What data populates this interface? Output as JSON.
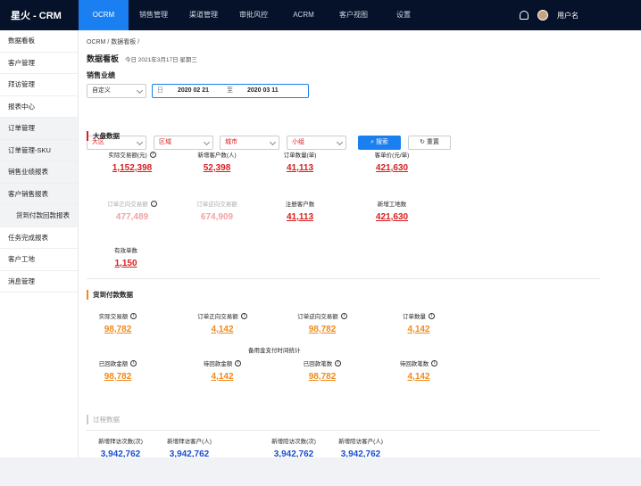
{
  "app": {
    "brand": "星火 - CRM"
  },
  "nav": {
    "items": [
      "OCRM",
      "销售管理",
      "渠道管理",
      "审批风控",
      "ACRM",
      "客户视图",
      "设置"
    ],
    "active_index": 0
  },
  "user": {
    "name": "用户名"
  },
  "sidebar": {
    "items": [
      "数据看板",
      "客户管理",
      "拜访管理",
      "报表中心",
      "订单管理",
      "订单管理-SKU",
      "销售业绩报表",
      "客户销售报表",
      "货到付款回款报表",
      "任务完成报表",
      "客户工地",
      "消息管理"
    ]
  },
  "breadcrumb": {
    "path": "OCRM / 数据看板 /"
  },
  "page": {
    "title": "数据看板",
    "date": "今日 2021年3月17日 星期三",
    "sales_label": "销售业绩"
  },
  "filters": {
    "date_mode": "自定义",
    "date_start": "2020 02 21",
    "date_to": "至",
    "date_end": "2020 03 11",
    "calendar_glyph": "日",
    "dropdowns": [
      "大区",
      "区域",
      "城市",
      "小组"
    ],
    "search_label": "搜索",
    "reset_label": "重置"
  },
  "sections": {
    "overview": "大盘数据",
    "cod": "货到付款数据",
    "process": "过程数据"
  },
  "overview_metrics": [
    {
      "label": "实际交易额(元)",
      "value": "1,152,398"
    },
    {
      "label": "新增客户数(人)",
      "value": "52,398"
    },
    {
      "label": "订单数量(单)",
      "value": "41,113"
    },
    {
      "label": "客单价(元/单)",
      "value": "421,630"
    },
    {
      "label": "订单正向交易额",
      "value": "477,489"
    },
    {
      "label": "订单逆向交易额",
      "value": "674,909"
    },
    {
      "label": "注册客户数",
      "value": "41,113"
    },
    {
      "label": "新增工地数",
      "value": "421,630"
    },
    {
      "label": "有效单数",
      "value": "1,150"
    }
  ],
  "cod_metrics": [
    {
      "label": "实际交易额",
      "value": "98,782"
    },
    {
      "label": "订单正向交易额",
      "value": "4,142"
    },
    {
      "label": "订单逆向交易额",
      "value": "98,782"
    },
    {
      "label": "订单数量",
      "value": "4,142"
    },
    {
      "label": "已回款金额",
      "value": "98,782"
    },
    {
      "label": "待回款金额",
      "value": "4,142"
    },
    {
      "label": "已回款笔数",
      "value": "98,782"
    },
    {
      "label": "待回款笔数",
      "value": "4,142"
    }
  ],
  "cod_note": "备用金支付时间统计",
  "process_metrics": [
    {
      "label": "新增拜访次数(次)",
      "value": "3,942,762"
    },
    {
      "label": "新增拜访客户(人)",
      "value": "3,942,762"
    },
    {
      "label": "新增陪访次数(次)",
      "value": "3,942,762"
    },
    {
      "label": "新增陪访客户(人)",
      "value": "3,942,762"
    }
  ],
  "colors": {
    "topbar": "#06122a",
    "accent": "#1a7ff0",
    "red": "#d81e1e",
    "orange": "#f08a1c"
  }
}
